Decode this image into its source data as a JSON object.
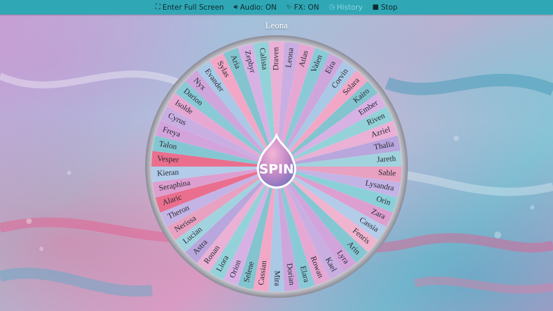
{
  "toolbar": {
    "fullscreen": {
      "icon": "expand-icon",
      "label": "Enter Full Screen"
    },
    "audio": {
      "icon": "speaker-icon",
      "label": "Audio: ON"
    },
    "fx": {
      "icon": "sparkle-icon",
      "label": "FX: ON"
    },
    "history": {
      "icon": "clock-icon",
      "label": "History"
    },
    "stop": {
      "icon": "stop-icon",
      "label": "Stop"
    }
  },
  "result_name": "Leona",
  "spin_label": "SPIN",
  "wheel": {
    "names": [
      "Leona",
      "Atlas",
      "Valen",
      "Eira",
      "Corvin",
      "Solara",
      "Kairo",
      "Ember",
      "Riven",
      "Azriel",
      "Thalia",
      "Jareth",
      "Sable",
      "Lysandra",
      "Orin",
      "Zara",
      "Cassia",
      "Fenris",
      "Arin",
      "Lyra",
      "Kael",
      "Rowan",
      "Elara",
      "Dorian",
      "Mira",
      "Cassian",
      "Selene",
      "Orion",
      "Liora",
      "Ronan",
      "Astra",
      "Lucian",
      "Nerissa",
      "Theron",
      "Alaric",
      "Seraphina",
      "Kieran",
      "Vesper",
      "Talon",
      "Freya",
      "Cyrus",
      "Isolde",
      "Darion",
      "Nyx",
      "Evander",
      "Sylas",
      "Aria",
      "Zephyr",
      "Calista",
      "Draven"
    ],
    "colors": [
      "#c9aee2",
      "#e6a8d3",
      "#89cad6",
      "#cfa6dc",
      "#a9c9e6",
      "#f3a7c7",
      "#83c4cf",
      "#d8b1e4",
      "#93d2d8",
      "#eab0d6",
      "#b8a6dc",
      "#a1d3df",
      "#e8a1c0",
      "#c4b4e6",
      "#8bd0d8",
      "#dd9fd0",
      "#b2cce9",
      "#f0b4cf",
      "#84c7d3",
      "#d3a4dc"
    ],
    "accent_colors": {
      "Vesper": "#ea6f8e",
      "Alaric": "#ea6f8e"
    },
    "rim_color": "#b8b8c2",
    "hub_color": "#9a8fc6"
  }
}
